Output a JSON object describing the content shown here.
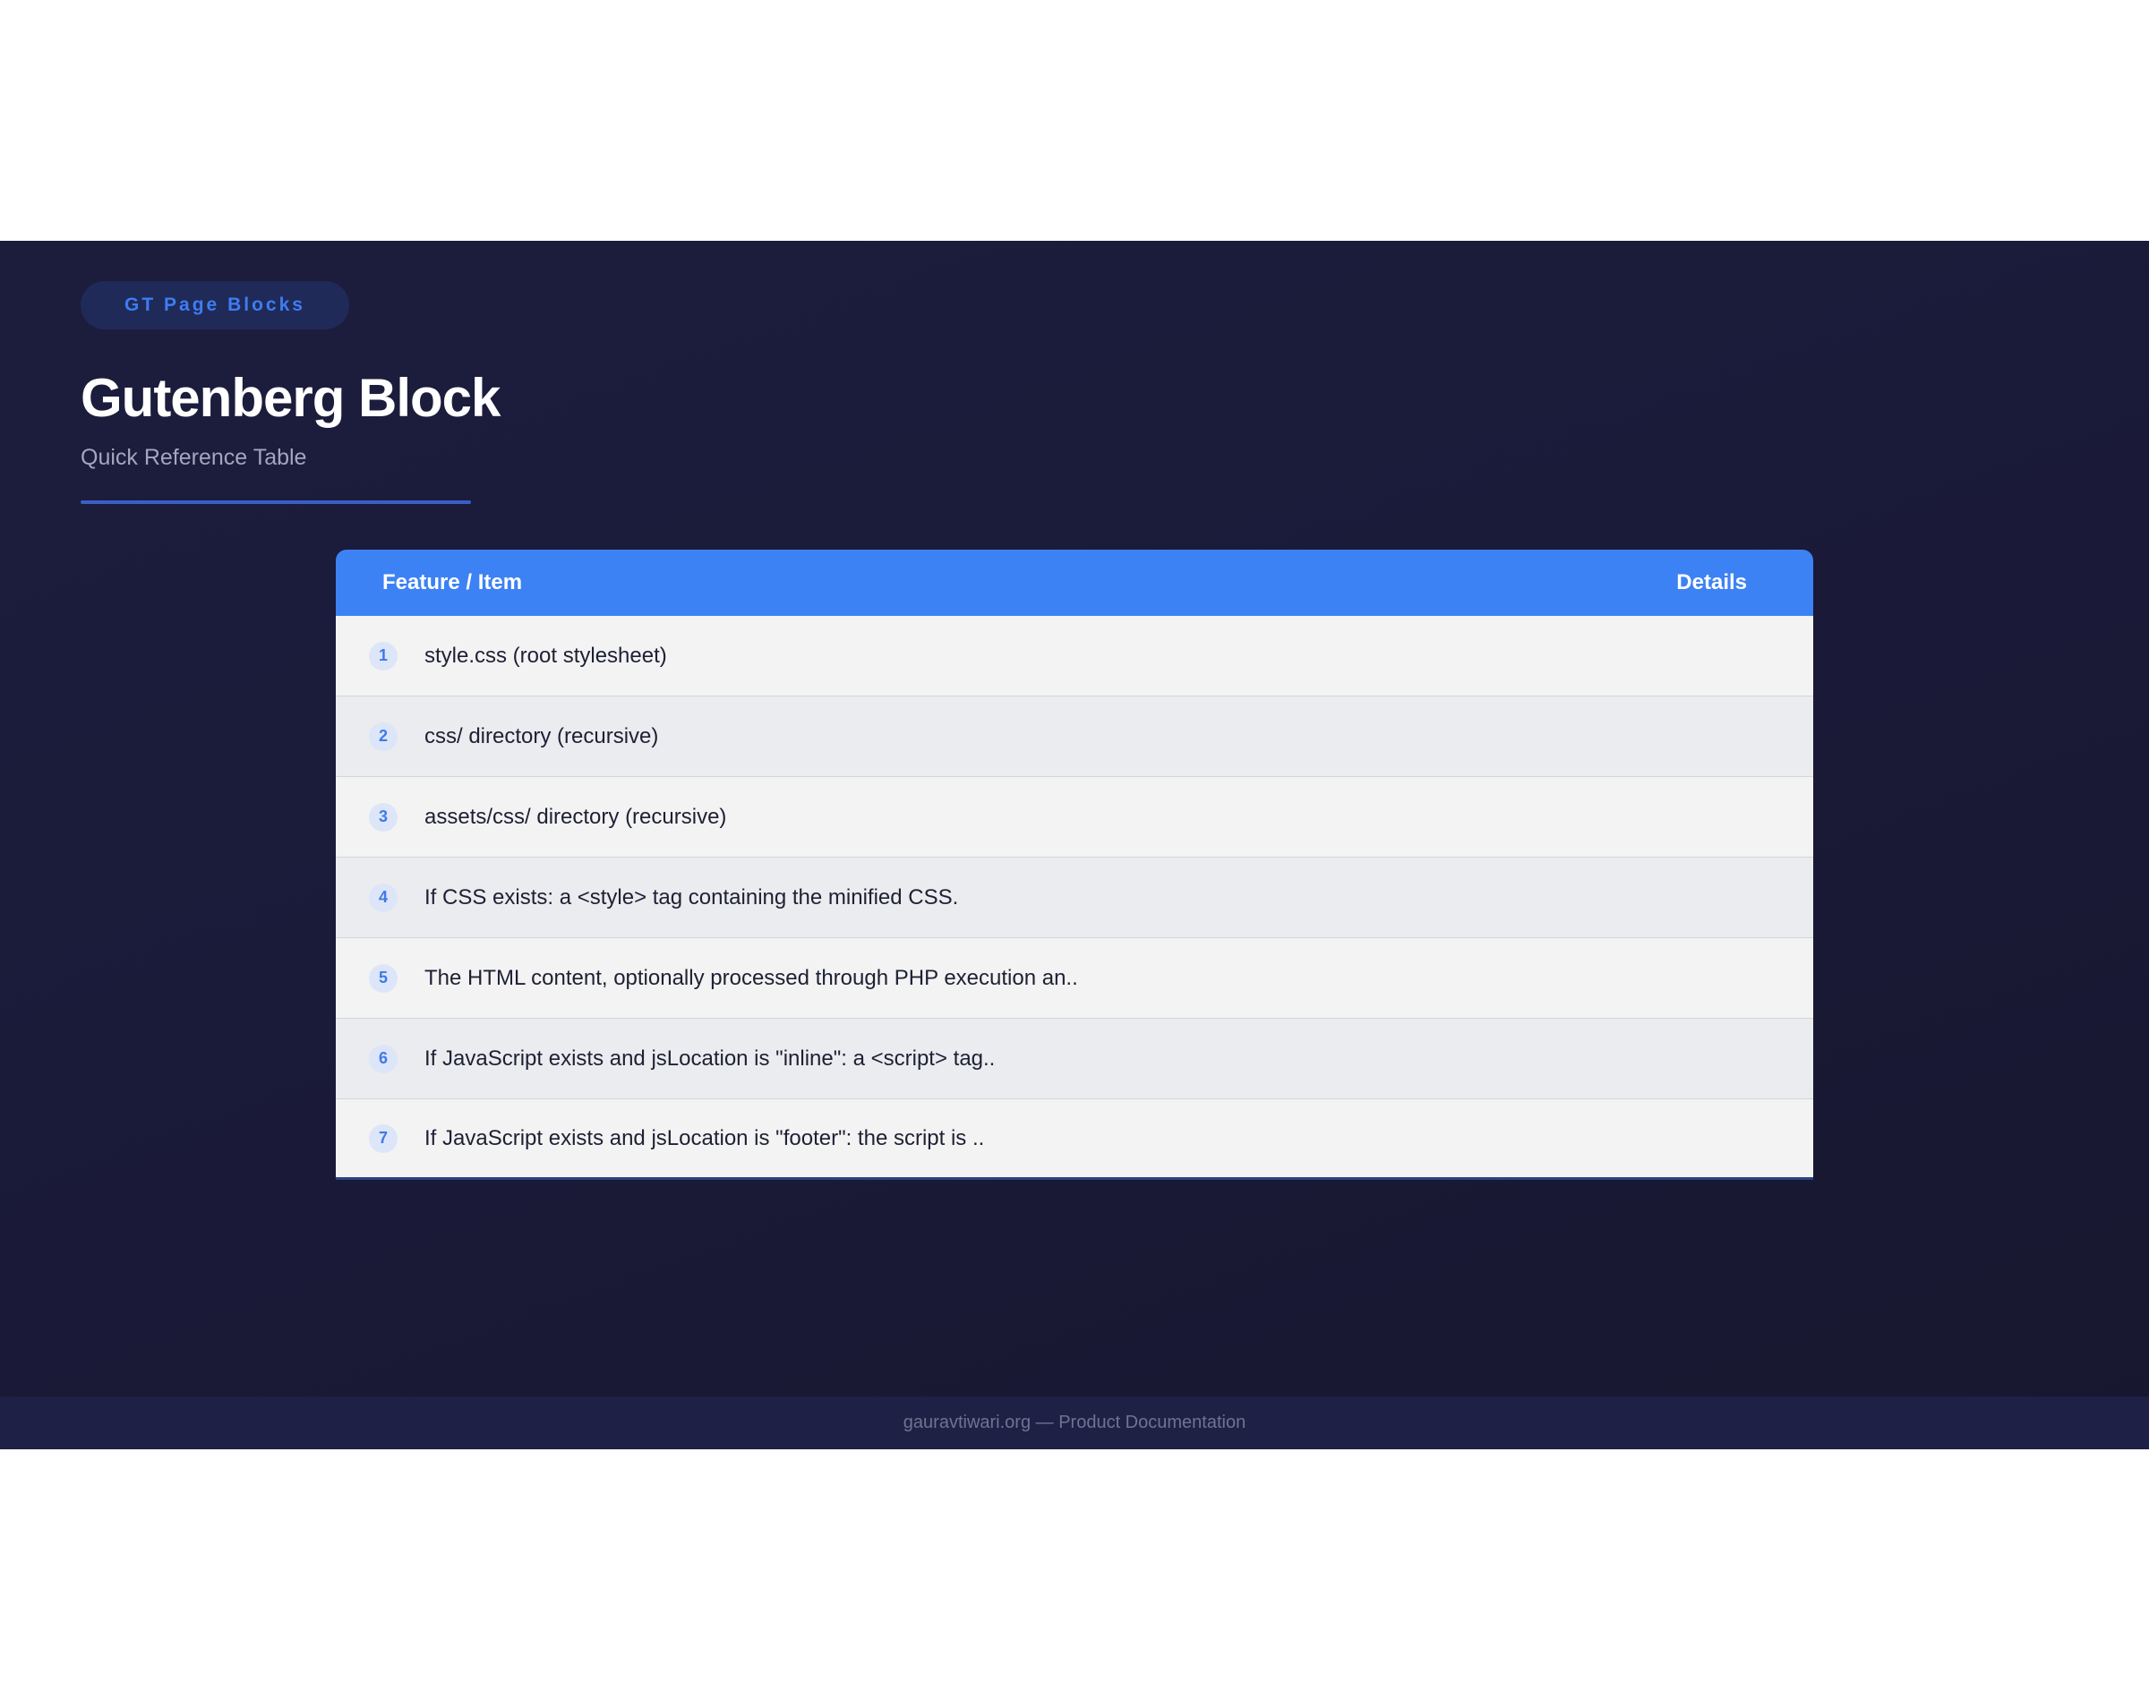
{
  "header": {
    "badge": "GT Page Blocks",
    "title": "Gutenberg Block",
    "subtitle": "Quick Reference Table"
  },
  "table": {
    "columns": [
      "Feature / Item",
      "Details"
    ],
    "rows": [
      {
        "num": "1",
        "text": "style.css (root stylesheet)"
      },
      {
        "num": "2",
        "text": "css/ directory (recursive)"
      },
      {
        "num": "3",
        "text": "assets/css/ directory (recursive)"
      },
      {
        "num": "4",
        "text": "If CSS exists: a <style> tag containing the minified CSS."
      },
      {
        "num": "5",
        "text": "The HTML content, optionally processed through PHP execution an.."
      },
      {
        "num": "6",
        "text": "If JavaScript exists and jsLocation is \"inline\": a <script> tag.."
      },
      {
        "num": "7",
        "text": "If JavaScript exists and jsLocation is \"footer\": the script is .."
      }
    ]
  },
  "footer": {
    "text": "gauravtiwari.org — Product Documentation"
  }
}
